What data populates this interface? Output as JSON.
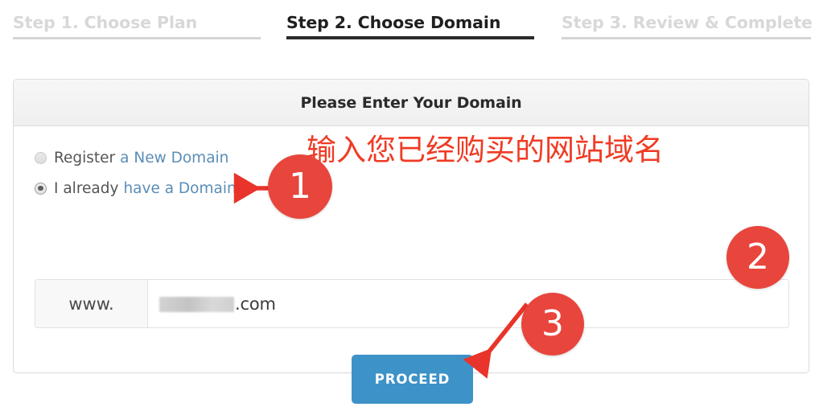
{
  "steps": [
    {
      "label": "Step 1. Choose Plan",
      "state": "inactive"
    },
    {
      "label": "Step 2. Choose Domain",
      "state": "active"
    },
    {
      "label": "Step 3. Review & Complete",
      "state": "inactive"
    }
  ],
  "panel": {
    "title": "Please Enter Your Domain",
    "options": [
      {
        "text": "Register",
        "link_text": "a New Domain",
        "selected": false
      },
      {
        "text": "I already",
        "link_text": "have a Domain",
        "selected": true
      }
    ],
    "domain_input": {
      "prefix": "www.",
      "value_redacted": true,
      "value_suffix": ".com"
    }
  },
  "annotations": {
    "note_text": "输入您已经购买的网站域名",
    "badges": [
      {
        "number": "1"
      },
      {
        "number": "2"
      },
      {
        "number": "3"
      }
    ],
    "color": "#e8453c",
    "note_color": "#ef3b24"
  },
  "actions": {
    "proceed_label": "PROCEED",
    "proceed_color": "#3d92c8"
  }
}
